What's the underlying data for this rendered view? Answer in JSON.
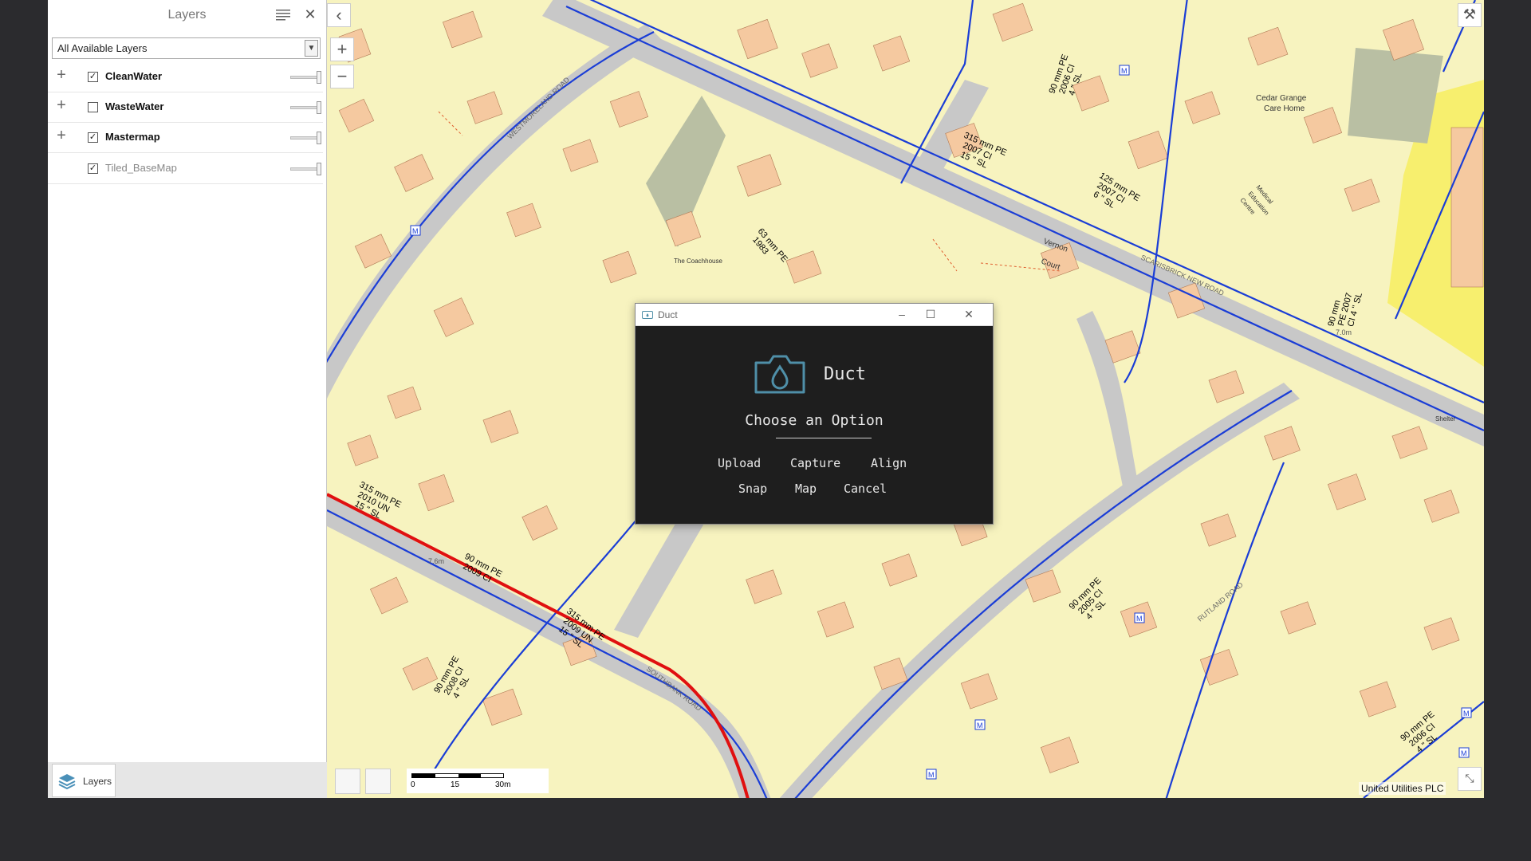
{
  "layers_panel": {
    "title": "Layers",
    "filter_selected": "All Available Layers",
    "layers": [
      {
        "name": "CleanWater",
        "checked": true,
        "expandable": true,
        "dim": false
      },
      {
        "name": "WasteWater",
        "checked": false,
        "expandable": true,
        "dim": false
      },
      {
        "name": "Mastermap",
        "checked": true,
        "expandable": true,
        "dim": false
      },
      {
        "name": "Tiled_BaseMap",
        "checked": true,
        "expandable": false,
        "dim": true
      }
    ],
    "footer_tab": "Layers"
  },
  "map": {
    "attribution": "United Utilities PLC",
    "scale": {
      "labels": [
        "0",
        "15",
        "30m"
      ]
    },
    "zoom_in": "+",
    "zoom_out": "−",
    "labels": {
      "road1": "WESTMORELAND ROAD",
      "road2": "SCARISBRICK NEW ROAD",
      "road3": "RUTLAND ROAD",
      "road4": "SOUTHBANK ROAD",
      "place1": "Cedar Grange",
      "place2": "Care Home",
      "place3": "The Coachhouse",
      "place4": "Vernon",
      "place5": "Court",
      "place6": "Medical",
      "place7": "Education",
      "place8": "Centre",
      "place9": "Shelter",
      "pipe1": "315 mm PE",
      "pipe1b": "2007 CI",
      "pipe1c": "15 \" SL",
      "pipe2": "125 mm PE",
      "pipe2b": "2007 CI",
      "pipe2c": "6 \" SL",
      "pipe3": "90 mm PE",
      "pipe3b": "2006 CI",
      "pipe3c": "4 \" SL",
      "pipe4": "315 mm PE",
      "pipe4b": "2010 UN",
      "pipe4c": "15 \" SL",
      "pipe5": "90 mm PE",
      "pipe5b": "2009 CI",
      "pipe6": "315 mm PE",
      "pipe6b": "2009 UN",
      "pipe6c": "15 \" SL",
      "pipe7": "90 mm PE",
      "pipe7b": "2008 CI",
      "pipe7c": "4 \" SL",
      "pipe8": "90 mm PE",
      "pipe8b": "2005 CI",
      "pipe8c": "4 \" SL",
      "pipe9": "63 mm PE",
      "pipe9b": "1983",
      "pipe10": "90 mm PE",
      "pipe10b": "2006 CI",
      "pipe10c": "4 \" SL",
      "pipe11": "90 mm",
      "pipe11b": "PE 2007",
      "pipe11c": "CI 4 \" SL",
      "dist1": "7.6m",
      "dist2": "7.0m",
      "m_marker": "M"
    }
  },
  "duct_window": {
    "title": "Duct",
    "app_name": "Duct",
    "prompt": "Choose an Option",
    "options": [
      "Upload",
      "Capture",
      "Align",
      "Snap",
      "Map",
      "Cancel"
    ],
    "icon": "camera-water-drop-icon",
    "accent": "#4f8fa8"
  },
  "colors": {
    "map_background": "#f7f3bf",
    "building": "#f5c9a0",
    "road": "#c8c8c8",
    "pipe_blue": "#1a3dd6",
    "pipe_red": "#e01010"
  }
}
